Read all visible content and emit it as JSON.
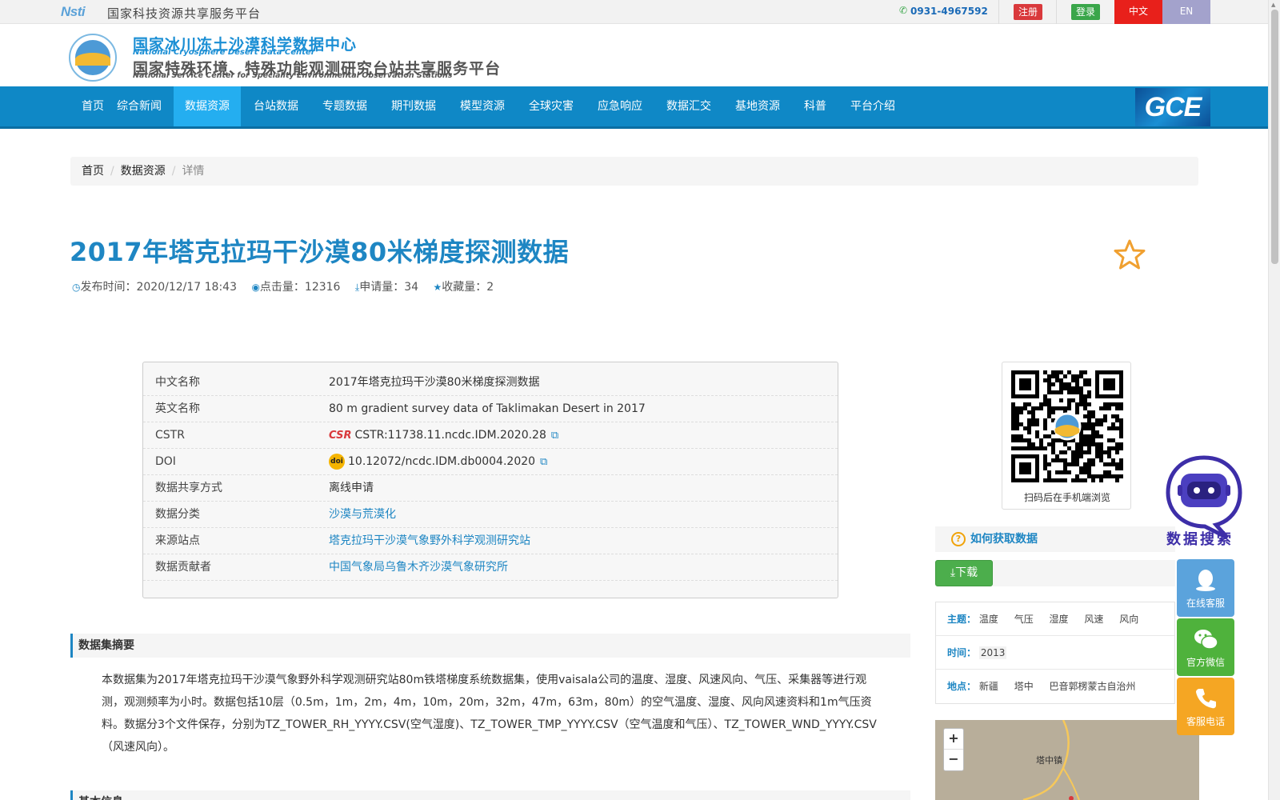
{
  "topbar": {
    "logo_text": "Nsti",
    "platform": "国家科技资源共享服务平台",
    "phone": "0931-4967592",
    "register": "注册",
    "login": "登录",
    "lang_cn": "中文",
    "lang_en": "EN"
  },
  "header": {
    "title_cn": "国家冰川冻土沙漠科学数据中心",
    "title_en": "National Cryosphere Desert Data Center",
    "subtitle_cn": "国家特殊环境、特殊功能观测研究台站共享服务平台",
    "subtitle_en": "National Service Center for Speciality Environmental Observation Stations"
  },
  "nav": {
    "items": [
      "首页",
      "综合新闻",
      "数据资源",
      "台站数据",
      "专题数据",
      "期刊数据",
      "模型资源",
      "全球灾害",
      "应急响应",
      "数据汇交",
      "基地资源",
      "科普",
      "平台介绍"
    ],
    "active_index": 2,
    "gce_label": "GCE"
  },
  "breadcrumb": {
    "home": "首页",
    "section": "数据资源",
    "current": "详情"
  },
  "dataset": {
    "title": "2017年塔克拉玛干沙漠80米梯度探测数据",
    "publish_label": "发布时间：",
    "publish_time": "2020/12/17 18:43",
    "clicks_label": "点击量：",
    "clicks": "12316",
    "requests_label": "申请量：",
    "requests": "34",
    "favorites_label": "收藏量：",
    "favorites": "2"
  },
  "info_table": {
    "rows": [
      {
        "key": "中文名称",
        "value": "2017年塔克拉玛干沙漠80米梯度探测数据"
      },
      {
        "key": "英文名称",
        "value": "80 m gradient survey data of Taklimakan Desert in 2017"
      },
      {
        "key": "CSTR",
        "value": "CSTR:11738.11.ncdc.IDM.2020.28"
      },
      {
        "key": "DOI",
        "value": "10.12072/ncdc.IDM.db0004.2020"
      },
      {
        "key": "数据共享方式",
        "value": "离线申请"
      },
      {
        "key": "数据分类",
        "value": "沙漠与荒漠化"
      },
      {
        "key": "来源站点",
        "value": "塔克拉玛干沙漠气象野外科学观测研究站"
      },
      {
        "key": "数据贡献者",
        "value": "中国气象局乌鲁木齐沙漠气象研究所"
      }
    ],
    "cstr_logo": "CSR",
    "doi_logo": "doi"
  },
  "sections": {
    "summary_title": "数据集摘要",
    "summary_text": "本数据集为2017年塔克拉玛干沙漠气象野外科学观测研究站80m铁塔梯度系统数据集，使用vaisala公司的温度、湿度、风速风向、气压、采集器等进行观测，观测频率为小时。数据包括10层（0.5m，1m，2m，4m，10m，20m，32m，47m，63m，80m）的空气温度、湿度、风向风速资料和1m气压资料。数据分3个文件保存，分别为TZ_TOWER_RH_YYYY.CSV(空气湿度)、TZ_TOWER_TMP_YYYY.CSV（空气温度和气压）、TZ_TOWER_WND_YYYY.CSV（风速风向）。",
    "basic_title": "基本信息"
  },
  "sidebar": {
    "qr_caption": "扫码后在手机端浏览",
    "how_to_get": "如何获取数据",
    "download": "下载",
    "topic_label": "主题：",
    "topics": [
      "温度",
      "气压",
      "湿度",
      "风速",
      "风向"
    ],
    "time_label": "时间：",
    "time_value": "2013",
    "place_label": "地点：",
    "places": [
      "新疆",
      "塔中",
      "巴音郭楞蒙古自治州"
    ],
    "map_label": "塔中镇",
    "map_zoom_in": "+",
    "map_zoom_out": "−"
  },
  "floating": {
    "robot_label": "数据搜索",
    "online_service": "在线客服",
    "wechat": "官方微信",
    "hotline": "客服电话"
  },
  "colors": {
    "nav_bg": "#0f88c6",
    "nav_active": "#24aef0",
    "title_blue": "#1e86c3",
    "register_red": "#d9393c",
    "login_green": "#3aa64a",
    "download_green": "#4cae4c",
    "side_blue": "#5ba3dc",
    "side_green": "#4fb23c",
    "side_orange": "#f5a623",
    "star_orange": "#f0a030"
  }
}
